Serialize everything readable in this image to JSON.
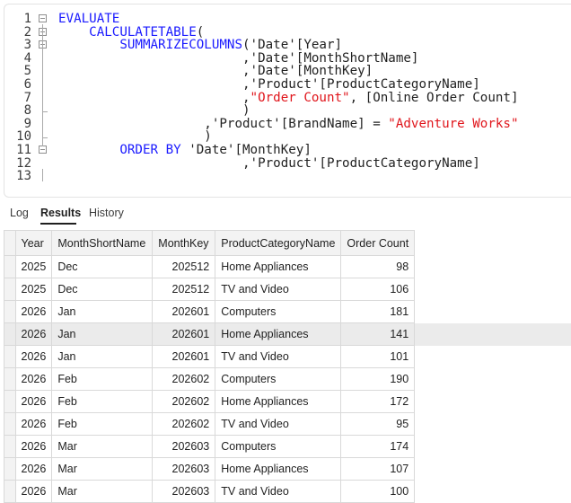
{
  "editor": {
    "lines": [
      {
        "n": "1",
        "parts": [
          [
            "kw",
            "EVALUATE"
          ]
        ]
      },
      {
        "n": "2",
        "parts": [
          [
            "id",
            "    "
          ],
          [
            "fn",
            "CALCULATETABLE"
          ],
          [
            "id",
            "("
          ]
        ]
      },
      {
        "n": "3",
        "parts": [
          [
            "id",
            "        "
          ],
          [
            "fn",
            "SUMMARIZECOLUMNS"
          ],
          [
            "id",
            "('Date'[Year]"
          ]
        ]
      },
      {
        "n": "4",
        "parts": [
          [
            "id",
            "                        ,'Date'[MonthShortName]"
          ]
        ]
      },
      {
        "n": "5",
        "parts": [
          [
            "id",
            "                        ,'Date'[MonthKey]"
          ]
        ]
      },
      {
        "n": "6",
        "parts": [
          [
            "id",
            "                        ,'Product'[ProductCategoryName]"
          ]
        ]
      },
      {
        "n": "7",
        "parts": [
          [
            "id",
            "                        ,"
          ],
          [
            "str",
            "\"Order Count\""
          ],
          [
            "id",
            ", [Online Order Count]"
          ]
        ]
      },
      {
        "n": "8",
        "parts": [
          [
            "id",
            "                        )"
          ]
        ]
      },
      {
        "n": "9",
        "parts": [
          [
            "id",
            "                   ,'Product'[BrandName] = "
          ],
          [
            "str",
            "\"Adventure Works\""
          ]
        ]
      },
      {
        "n": "10",
        "parts": [
          [
            "id",
            "                   )"
          ]
        ]
      },
      {
        "n": "11",
        "parts": [
          [
            "id",
            "        "
          ],
          [
            "kw",
            "ORDER BY"
          ],
          [
            "id",
            " 'Date'[MonthKey]"
          ]
        ]
      },
      {
        "n": "12",
        "parts": [
          [
            "id",
            "                        ,'Product'[ProductCategoryName]"
          ]
        ]
      },
      {
        "n": "13",
        "parts": []
      }
    ]
  },
  "tabs": [
    "Log",
    "Results",
    "History"
  ],
  "active_tab": "Results",
  "results": {
    "columns": [
      "Year",
      "MonthShortName",
      "MonthKey",
      "ProductCategoryName",
      "Order Count"
    ],
    "rows": [
      [
        "2025",
        "Dec",
        "202512",
        "Home Appliances",
        "98"
      ],
      [
        "2025",
        "Dec",
        "202512",
        "TV and Video",
        "106"
      ],
      [
        "2026",
        "Jan",
        "202601",
        "Computers",
        "181"
      ],
      [
        "2026",
        "Jan",
        "202601",
        "Home Appliances",
        "141"
      ],
      [
        "2026",
        "Jan",
        "202601",
        "TV and Video",
        "101"
      ],
      [
        "2026",
        "Feb",
        "202602",
        "Computers",
        "190"
      ],
      [
        "2026",
        "Feb",
        "202602",
        "Home Appliances",
        "172"
      ],
      [
        "2026",
        "Feb",
        "202602",
        "TV and Video",
        "95"
      ],
      [
        "2026",
        "Mar",
        "202603",
        "Computers",
        "174"
      ],
      [
        "2026",
        "Mar",
        "202603",
        "Home Appliances",
        "107"
      ],
      [
        "2026",
        "Mar",
        "202603",
        "TV and Video",
        "100"
      ]
    ],
    "selected_row": 3
  },
  "colors": {
    "keyword": "#1a1aff",
    "string": "#e0151b",
    "selected_row_bg": "#ebebeb",
    "header_bg": "#f3f3f3"
  }
}
